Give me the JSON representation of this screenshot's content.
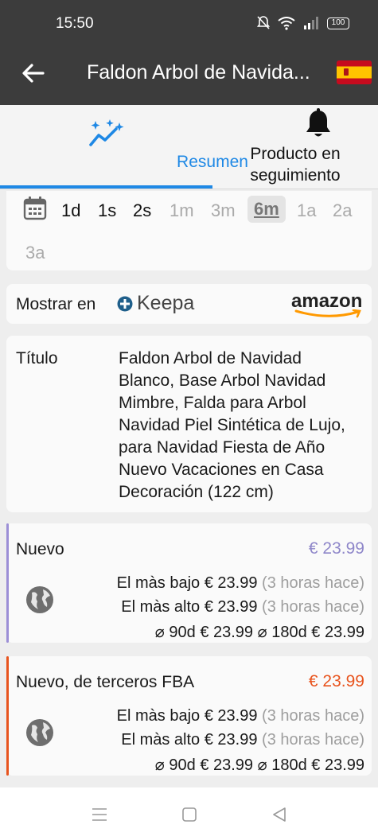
{
  "status": {
    "time": "15:50",
    "battery": "100"
  },
  "appbar": {
    "title": "Faldon Arbol de Navida..."
  },
  "tabs": [
    {
      "label": "Resumen"
    },
    {
      "label": "Producto en seguimiento"
    }
  ],
  "range": {
    "options": [
      "1d",
      "1s",
      "2s",
      "1m",
      "3m",
      "6m",
      "1a",
      "2a",
      "3a"
    ],
    "selected": "6m"
  },
  "show_in": {
    "label": "Mostrar en",
    "keepa": "Keepa",
    "amazon": "amazon"
  },
  "product": {
    "title_label": "Título",
    "title": "Faldon Arbol de Navidad Blanco, Base Arbol Navidad Mimbre, Falda para Arbol Navidad Piel Sintética de Lujo, para Navidad Fiesta de Año Nuevo Vacaciones en Casa Decoración (122 cm)"
  },
  "prices": [
    {
      "name": "Nuevo",
      "price": "€ 23.99",
      "color": "#8e86c9",
      "bar_color": "#9c8fd6",
      "lowest_label": "El màs bajo",
      "lowest": "€ 23.99",
      "lowest_when": "(3 horas hace)",
      "highest_label": "El màs alto",
      "highest": "€ 23.99",
      "highest_when": "(3 horas hace)",
      "avg90_label": "⌀ 90d",
      "avg90": "€ 23.99",
      "avg180_label": "⌀ 180d",
      "avg180": "€ 23.99"
    },
    {
      "name": "Nuevo, de terceros FBA",
      "price": "€ 23.99",
      "color": "#e8541e",
      "bar_color": "#e8541e",
      "lowest_label": "El màs bajo",
      "lowest": "€ 23.99",
      "lowest_when": "(3 horas hace)",
      "highest_label": "El màs alto",
      "highest": "€ 23.99",
      "highest_when": "(3 horas hace)",
      "avg90_label": "⌀ 90d",
      "avg90": "€ 23.99",
      "avg180_label": "⌀ 180d",
      "avg180": "€ 23.99"
    }
  ],
  "icons": [
    "back-arrow-icon",
    "spain-flag-icon",
    "chart-sparkle-icon",
    "bell-icon",
    "calendar-icon",
    "keepa-logo-icon",
    "amazon-logo-icon",
    "globe-icon",
    "nav-menu-icon",
    "nav-home-icon",
    "nav-back-icon"
  ]
}
